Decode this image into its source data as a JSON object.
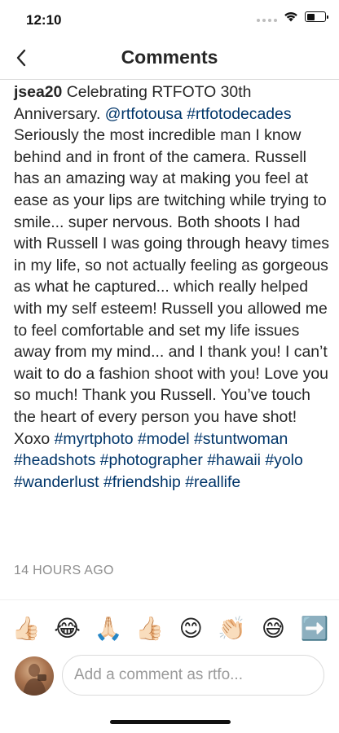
{
  "status_bar": {
    "time": "12:10",
    "icons": [
      "signal-dots-icon",
      "wifi-icon",
      "battery-icon"
    ]
  },
  "nav": {
    "back_icon": "chevron-left-icon",
    "title": "Comments"
  },
  "comment": {
    "username": "jsea20",
    "text_1": " Celebrating RTFOTO 30th Anniversary. ",
    "tag_1": "@rtfotousa",
    "tag_2": "#rtfotodecades",
    "text_2": " Seriously the most incredible man I know behind and in front of the camera. Russell has an amazing way at making you feel at ease as your lips are twitching while trying to smile... super nervous. Both shoots I had with Russell I was going through heavy times in my life, so not actually feeling as gorgeous as what he captured... which really helped with my self esteem! Russell you allowed me to feel comfortable and set my life issues away from my mind... and I thank you! I can’t wait to do a fashion shoot with you! Love you so much! Thank you Russell. You’ve touch the heart of every person you have shot! Xoxo ",
    "tag_3": "#myrtphoto",
    "tag_4": "#model",
    "tag_5": "#stuntwoman",
    "tag_6": "#headshots",
    "tag_7": "#photographer",
    "tag_8": "#hawaii",
    "tag_9": "#yolo",
    "tag_10": "#wanderlust",
    "tag_11": "#friendship",
    "tag_12": "#reallife",
    "timestamp": "14 HOURS AGO"
  },
  "emoji_bar": {
    "items": [
      "👍🏻",
      "😂",
      "🙏🏻",
      "👍🏻",
      "😊",
      "👏🏻",
      "😅",
      "➡️"
    ]
  },
  "composer": {
    "placeholder": "Add a comment as rtfo..."
  },
  "colors": {
    "hashtag": "#003569",
    "text": "#262626",
    "muted": "#8e8e8e",
    "border": "#dbdbdb"
  }
}
